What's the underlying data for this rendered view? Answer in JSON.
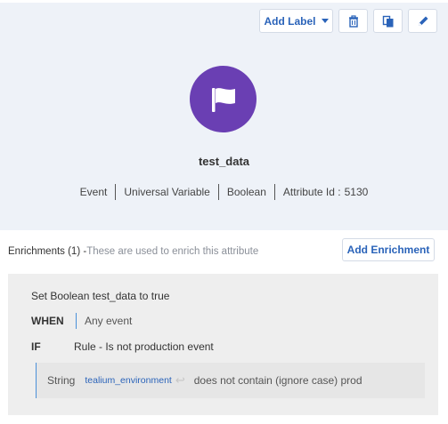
{
  "toolbar": {
    "add_label": "Add Label",
    "delete_icon": "trash-icon",
    "copy_icon": "copy-icon",
    "edit_icon": "pencil-icon"
  },
  "attribute": {
    "icon": "flag-icon",
    "name": "test_data",
    "scope": "Event",
    "type": "Universal Variable",
    "data_type": "Boolean",
    "id_label": "Attribute Id :",
    "id_value": "5130"
  },
  "enrichments": {
    "title": "Enrichments (1) -",
    "hint": "These are used to enrich this attribute",
    "add_button": "Add Enrichment",
    "items": [
      {
        "title": "Set Boolean test_data to true",
        "when_label": "WHEN",
        "when_value": "Any event",
        "if_label": "IF",
        "rule_name": "Rule - Is not production event",
        "condition": {
          "type": "String",
          "variable": "tealium_environment",
          "variable_icon": "reply-icon",
          "operator": "does not contain (ignore case) prod"
        }
      }
    ]
  },
  "colors": {
    "accent": "#2a63b9",
    "badge": "#6a3fb3",
    "panel_bg": "#eef2f8",
    "card_bg": "#eeeeee"
  }
}
